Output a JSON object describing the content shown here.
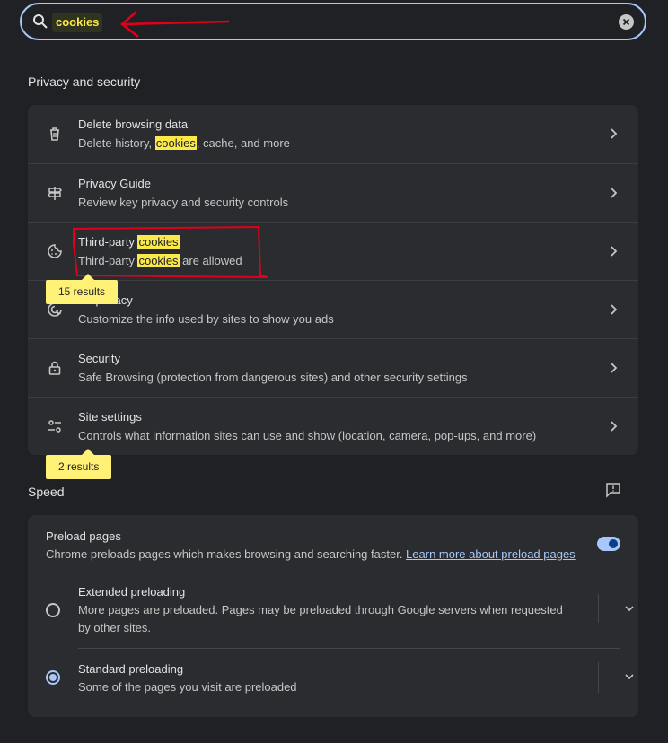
{
  "search": {
    "query": "cookies"
  },
  "privacy": {
    "title": "Privacy and security",
    "items": [
      {
        "icon": "trash-icon",
        "title": "Delete browsing data",
        "sub_pre": "Delete history, ",
        "sub_hl": "cookies",
        "sub_post": ", cache, and more"
      },
      {
        "icon": "signpost-icon",
        "title": "Privacy Guide",
        "sub": "Review key privacy and security controls"
      },
      {
        "icon": "cookie-icon",
        "title_pre": "Third-party ",
        "title_hl": "cookies",
        "sub_pre": "Third-party ",
        "sub_hl": "cookies",
        "sub_post": " are allowed"
      },
      {
        "icon": "ad-privacy-icon",
        "title": "Ad privacy",
        "sub": "Customize the info used by sites to show you ads"
      },
      {
        "icon": "lock-icon",
        "title": "Security",
        "sub": "Safe Browsing (protection from dangerous sites) and other security settings"
      },
      {
        "icon": "sliders-icon",
        "title": "Site settings",
        "sub": "Controls what information sites can use and show (location, camera, pop-ups, and more)"
      }
    ],
    "bubbles": [
      "15 results",
      "2 results"
    ]
  },
  "speed": {
    "title": "Speed",
    "preload": {
      "title": "Preload pages",
      "sub": "Chrome preloads pages which makes browsing and searching faster. ",
      "link": "Learn more about preload pages",
      "enabled": true
    },
    "options": [
      {
        "title": "Extended preloading",
        "sub": "More pages are preloaded. Pages may be preloaded through Google servers when requested by other sites.",
        "selected": false
      },
      {
        "title": "Standard preloading",
        "sub": "Some of the pages you visit are preloaded",
        "selected": true
      }
    ]
  },
  "colors": {
    "background": "#202124",
    "card": "#2b2c2f",
    "accent": "#a8c7fa",
    "highlight": "#fbe94a",
    "annotation": "#e0001b"
  }
}
